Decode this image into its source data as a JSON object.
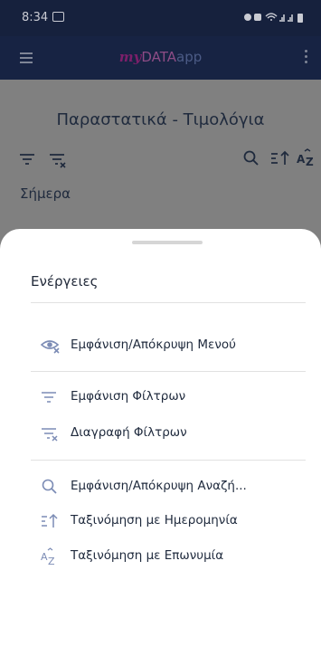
{
  "status_bar": {
    "time": "8:34"
  },
  "app_bar": {
    "logo_my": "my",
    "logo_data": "DATA",
    "logo_app": "app"
  },
  "page": {
    "title": "Παραστατικά - Τιμολόγια",
    "today_label": "Σήμερα"
  },
  "sheet": {
    "title": "Ενέργειες",
    "items": [
      {
        "label": "Εμφάνιση/Απόκρυψη Μενού",
        "icon": "eye-hide-icon"
      },
      {
        "label": "Εμφάνιση Φίλτρων",
        "icon": "filter-icon"
      },
      {
        "label": "Διαγραφή Φίλτρων",
        "icon": "filter-clear-icon"
      },
      {
        "label": "Εμφάνιση/Απόκρυψη Αναζή...",
        "icon": "search-icon"
      },
      {
        "label": "Ταξινόμηση με Ημερομηνία",
        "icon": "sort-date-icon"
      },
      {
        "label": "Ταξινόμηση με Επωνυμία",
        "icon": "sort-az-icon"
      }
    ]
  },
  "colors": {
    "accent": "#7c8cb5",
    "text": "#1f2a3d",
    "scrim": "#808080",
    "app_bar": "#172343"
  }
}
